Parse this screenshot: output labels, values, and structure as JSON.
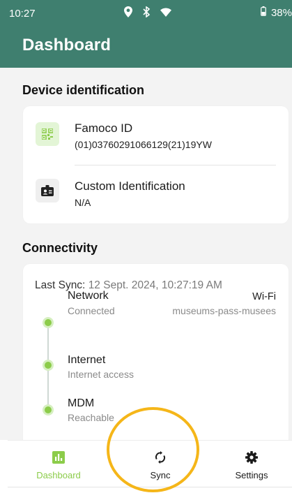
{
  "status_bar": {
    "time": "10:27",
    "battery": "38%",
    "icons": [
      "location-icon",
      "bluetooth-icon",
      "wifi-icon",
      "battery-icon"
    ]
  },
  "app_bar": {
    "title": "Dashboard"
  },
  "device_identification": {
    "title": "Device identification",
    "items": [
      {
        "label": "Famoco ID",
        "value": "(01)03760291066129(21)19YW",
        "icon": "qr-code-icon"
      },
      {
        "label": "Custom Identification",
        "value": "N/A",
        "icon": "id-badge-icon"
      }
    ]
  },
  "connectivity": {
    "title": "Connectivity",
    "last_sync_label": "Last Sync:",
    "last_sync_value": "12 Sept. 2024, 10:27:19 AM",
    "items": [
      {
        "name": "Network",
        "status": "Connected",
        "type": "Wi-Fi",
        "ssid": "museums-pass-musees"
      },
      {
        "name": "Internet",
        "status": "Internet access"
      },
      {
        "name": "MDM",
        "status": "Reachable"
      }
    ]
  },
  "bottom_nav": {
    "items": [
      {
        "label": "Dashboard",
        "icon": "chart-icon",
        "active": true
      },
      {
        "label": "Sync",
        "icon": "sync-icon",
        "active": false
      },
      {
        "label": "Settings",
        "icon": "gear-icon",
        "active": false
      }
    ]
  },
  "colors": {
    "primary": "#3f7f6f",
    "accent_green": "#8ccc4a",
    "highlight": "#f5b619"
  }
}
